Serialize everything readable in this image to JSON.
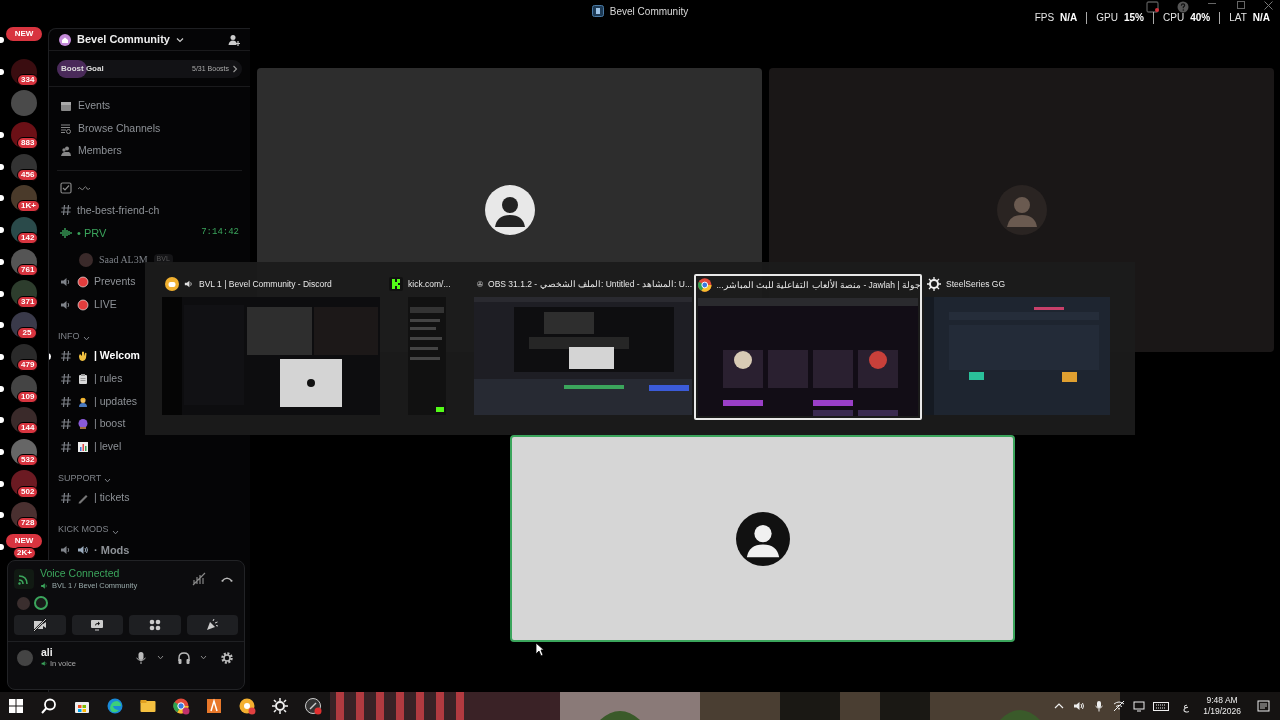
{
  "window": {
    "title": "Bevel Community"
  },
  "perf_overlay": [
    {
      "label": "FPS",
      "value": "N/A"
    },
    {
      "label": "GPU",
      "value": "15%"
    },
    {
      "label": "CPU",
      "value": "40%"
    },
    {
      "label": "LAT",
      "value": "N/A"
    }
  ],
  "servers": [
    {
      "badge": "NEW",
      "kind": "new",
      "unread": true
    },
    {
      "badge": "334",
      "kind": "count",
      "unread": true
    },
    {
      "kind": "plain",
      "unread": false
    },
    {
      "badge": "883",
      "kind": "count",
      "unread": true
    },
    {
      "badge": "456",
      "kind": "count",
      "unread": true
    },
    {
      "badge": "1K+",
      "kind": "count",
      "unread": true
    },
    {
      "badge": "142",
      "kind": "count",
      "unread": true
    },
    {
      "badge": "761",
      "kind": "count",
      "unread": true
    },
    {
      "badge": "371",
      "kind": "count",
      "unread": true
    },
    {
      "badge": "25",
      "kind": "count",
      "unread": true
    },
    {
      "badge": "479",
      "kind": "count",
      "unread": true
    },
    {
      "badge": "109",
      "kind": "count",
      "unread": true
    },
    {
      "badge": "144",
      "kind": "count",
      "unread": true
    },
    {
      "badge": "532",
      "kind": "count",
      "unread": true
    },
    {
      "badge": "502",
      "kind": "count",
      "unread": true
    },
    {
      "badge": "728",
      "kind": "count",
      "unread": true
    },
    {
      "badge": "NEW",
      "count": "2K+",
      "kind": "new",
      "unread": true
    }
  ],
  "server_header": {
    "name": "Bevel Community"
  },
  "boost_goal": {
    "label": "Boost Goal",
    "progress": "5/31 Boosts",
    "level": 0.16
  },
  "nav": [
    {
      "label": "Events",
      "kind": "events"
    },
    {
      "label": "Browse Channels",
      "kind": "browse"
    },
    {
      "label": "Members",
      "kind": "members"
    }
  ],
  "channels": [
    {
      "kind": "check"
    },
    {
      "kind": "text",
      "label": "the-best-friend-ch",
      "unread": false
    },
    {
      "kind": "voice",
      "label": "• PRV",
      "live": true,
      "timer": "7:14:42",
      "members": [
        {
          "name": "Saad AL3M",
          "tag": "BVL"
        }
      ]
    },
    {
      "kind": "stage",
      "label": "Prevents",
      "emoji": {
        "kind": "red_dot"
      }
    },
    {
      "kind": "stage",
      "label": "LIVE",
      "emoji": {
        "kind": "red_dot"
      }
    },
    {
      "kind": "category",
      "label": "INFO"
    },
    {
      "kind": "text",
      "label": "| Welcom",
      "emoji": {
        "kind": "wave"
      },
      "unread": true
    },
    {
      "kind": "text",
      "label": "| rules",
      "emoji": {
        "kind": "clipboard"
      },
      "unread": false
    },
    {
      "kind": "text",
      "label": "| updates",
      "emoji": {
        "kind": "worker"
      },
      "unread": false
    },
    {
      "kind": "text",
      "label": "| boost",
      "emoji": {
        "kind": "orb"
      },
      "unread": false
    },
    {
      "kind": "text",
      "label": "| level",
      "emoji": {
        "kind": "chart"
      },
      "unread": false
    },
    {
      "kind": "category",
      "label": "SUPPORT"
    },
    {
      "kind": "text",
      "label": "| tickets",
      "emoji": {
        "kind": "pen"
      },
      "unread": false
    },
    {
      "kind": "category",
      "label": "KICK MODS"
    },
    {
      "kind": "voice",
      "label": "· Mods",
      "live": false,
      "emoji": {
        "kind": "speaker"
      }
    }
  ],
  "voice_panel": {
    "status": "Voice Connected",
    "channel": "BVL 1 / Bevel Community"
  },
  "user": {
    "name": "ali",
    "status": "In voice"
  },
  "stage_tiles": [
    {
      "kind": "grey",
      "speaking": false
    },
    {
      "kind": "dark",
      "speaking": false
    },
    {
      "kind": "light",
      "speaking": true
    }
  ],
  "app_switcher": [
    {
      "kind": "discord",
      "title": "BVL 1 | Bevel Community - Discord",
      "selected": false
    },
    {
      "kind": "kick",
      "title": "kick.com/...",
      "selected": false
    },
    {
      "kind": "obs",
      "title": "OBS 31.1.2 - الملف الشخصي: Untitled - المشاهد: U...",
      "selected": false
    },
    {
      "kind": "chrome",
      "title": "جولة | Jawlah - منصة الألعاب التفاعلية للبث المباشر...",
      "selected": true
    },
    {
      "kind": "steelseries",
      "title": "SteelSeries GG",
      "selected": false
    }
  ],
  "taskbar": {
    "apps": [
      {
        "kind": "start"
      },
      {
        "kind": "search"
      },
      {
        "kind": "store"
      },
      {
        "kind": "edge"
      },
      {
        "kind": "explorer"
      },
      {
        "kind": "chrome"
      },
      {
        "kind": "triangle"
      },
      {
        "kind": "ring"
      },
      {
        "kind": "steelseries"
      },
      {
        "kind": "obs"
      }
    ],
    "language": "ع",
    "time": "9:48 AM",
    "date": "1/19/2026"
  }
}
